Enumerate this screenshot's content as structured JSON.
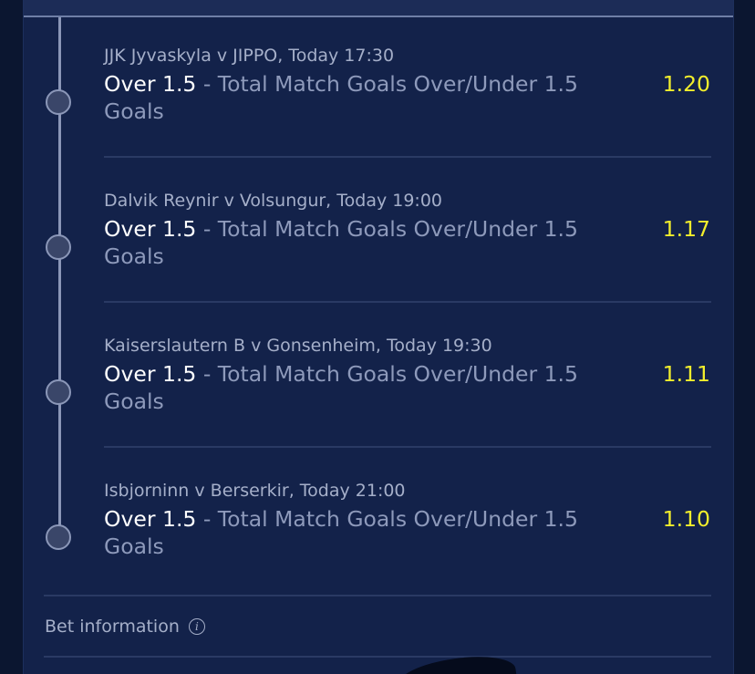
{
  "legs": [
    {
      "event": "JJK Jyvaskyla v JIPPO, Today 17:30",
      "pick": "Over 1.5",
      "market": " - Total Match Goals Over/Under 1.5 Goals",
      "odds": "1.20"
    },
    {
      "event": "Dalvik Reynir v Volsungur, Today 19:00",
      "pick": "Over 1.5",
      "market": " - Total Match Goals Over/Under 1.5 Goals",
      "odds": "1.17"
    },
    {
      "event": "Kaiserslautern B v Gonsenheim, Today 19:30",
      "pick": "Over 1.5",
      "market": " - Total Match Goals Over/Under 1.5 Goals",
      "odds": "1.11"
    },
    {
      "event": "Isbjorninn v Berserkir, Today 21:00",
      "pick": "Over 1.5",
      "market": " - Total Match Goals Over/Under 1.5 Goals",
      "odds": "1.10"
    }
  ],
  "bet_information": {
    "label": "Bet information",
    "icon": "info-icon"
  },
  "colors": {
    "background": "#13224a",
    "odds": "#f2ee2c",
    "pick": "#ffffff",
    "secondary_text": "#a5afc9"
  }
}
